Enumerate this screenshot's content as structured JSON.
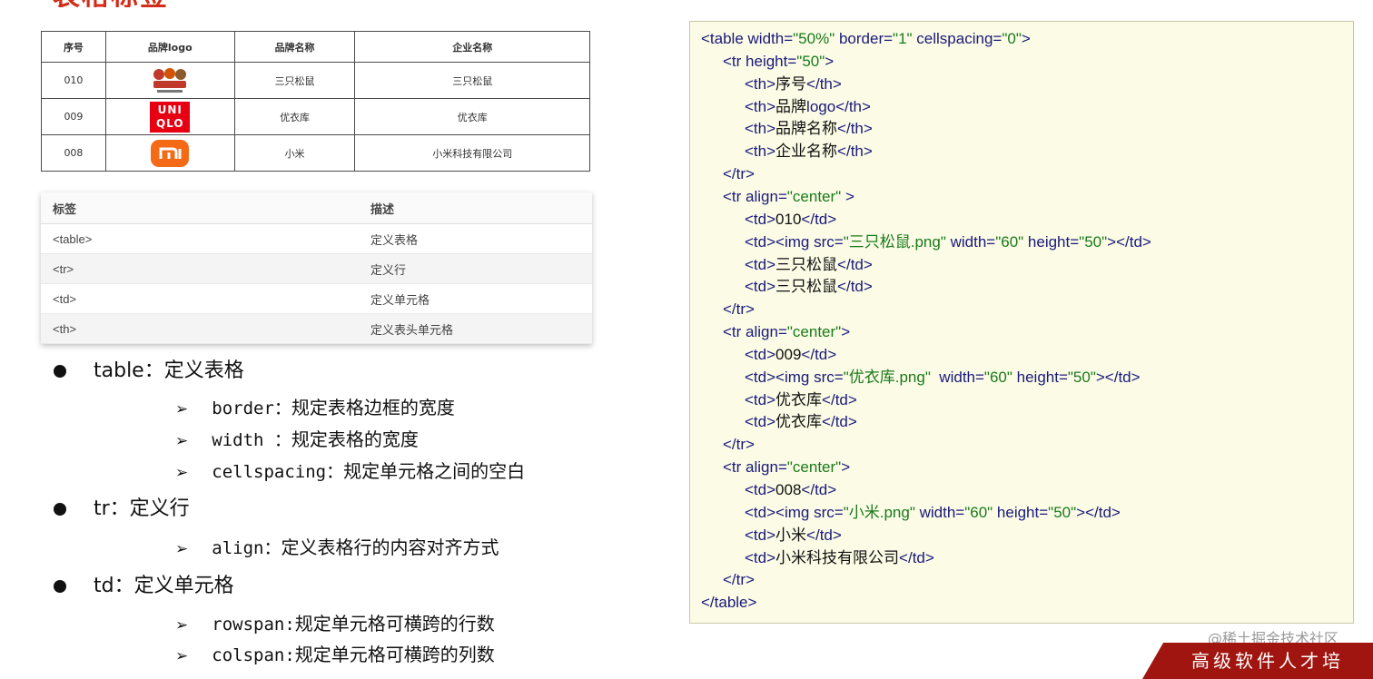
{
  "page": {
    "title": "表格标签"
  },
  "demo_table": {
    "headers": [
      "序号",
      "品牌logo",
      "品牌名称",
      "企业名称"
    ],
    "rows": [
      {
        "num": "010",
        "logo": "squirrel-logo",
        "brand": "三只松鼠",
        "company": "三只松鼠"
      },
      {
        "num": "009",
        "logo": "uniqlo-logo",
        "logo_text_1": "UNI",
        "logo_text_2": "QLO",
        "brand": "优衣库",
        "company": "优衣库"
      },
      {
        "num": "008",
        "logo": "mi-logo",
        "brand": "小米",
        "company": "小米科技有限公司"
      }
    ]
  },
  "tag_table": {
    "headers": [
      "标签",
      "描述"
    ],
    "rows": [
      {
        "tag": "<table>",
        "desc": "定义表格"
      },
      {
        "tag": "<tr>",
        "desc": "定义行"
      },
      {
        "tag": "<td>",
        "desc": "定义单元格"
      },
      {
        "tag": "<th>",
        "desc": "定义表头单元格"
      }
    ]
  },
  "bullets": [
    {
      "text": "table：定义表格",
      "sub": [
        {
          "kw": "border：",
          "desc": "规定表格边框的宽度"
        },
        {
          "kw": "width ：",
          "desc": "规定表格的宽度"
        },
        {
          "kw": "cellspacing：",
          "desc": "规定单元格之间的空白"
        }
      ]
    },
    {
      "text": "tr：定义行",
      "sub": [
        {
          "kw": "align：",
          "desc": "定义表格行的内容对齐方式"
        }
      ]
    },
    {
      "text": "td：定义单元格",
      "sub": [
        {
          "kw": "rowspan:",
          "desc": "规定单元格可横跨的行数"
        },
        {
          "kw": "colspan:",
          "desc": "规定单元格可横跨的列数"
        }
      ]
    }
  ],
  "code_lines": [
    "<table width=\"50%\" border=\"1\" cellspacing=\"0\">",
    "<tr height=\"50\">",
    "<th>序号</th>",
    "<th>品牌logo</th>",
    "<th>品牌名称</th>",
    "<th>企业名称</th>",
    "</tr>",
    "<tr align=\"center\" >",
    "<td>010</td>",
    "<td><img src=\"三只松鼠.png\" width=\"60\" height=\"50\"></td>",
    "<td>三只松鼠</td>",
    "<td>三只松鼠</td>",
    "</tr>",
    "<tr align=\"center\">",
    "<td>009</td>",
    "<td><img src=\"优衣库.png\"  width=\"60\" height=\"50\"></td>",
    "<td>优衣库</td>",
    "<td>优衣库</td>",
    "</tr>",
    "<tr align=\"center\">",
    "<td>008</td>",
    "<td><img src=\"小米.png\" width=\"60\" height=\"50\"></td>",
    "<td>小米</td>",
    "<td>小米科技有限公司</td>",
    "</tr>",
    "</table>"
  ],
  "watermark": "@稀土掘金技术社区",
  "banner": "高级软件人才培",
  "colors": {
    "title": "#d22d18",
    "code_bg": "#fbfbe6",
    "code_tag": "#1a1a7a",
    "code_value": "#1a7a1a",
    "uniqlo": "#e60012",
    "mi": "#f56a16",
    "banner": "#a01510"
  }
}
